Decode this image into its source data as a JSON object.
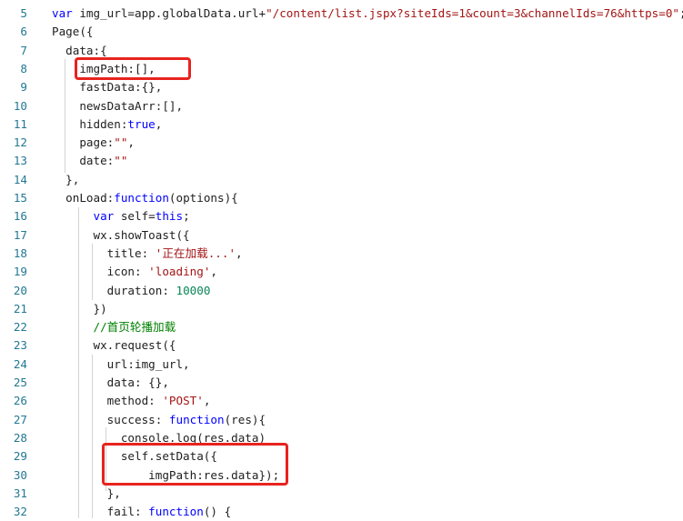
{
  "editor": {
    "lines": [
      {
        "no": "5",
        "segments": [
          {
            "t": "var",
            "c": "kw"
          },
          {
            "t": " img_url=app.globalData.url+",
            "c": ""
          },
          {
            "t": "\"/content/list.jspx?siteIds=1&count=3&channelIds=76&https=0\"",
            "c": "str"
          },
          {
            "t": ";",
            "c": ""
          }
        ]
      },
      {
        "no": "6",
        "segments": [
          {
            "t": "Page({",
            "c": ""
          }
        ]
      },
      {
        "no": "7",
        "segments": [
          {
            "t": "  data:{",
            "c": ""
          }
        ]
      },
      {
        "no": "8",
        "segments": [
          {
            "t": "    imgPath:[],",
            "c": ""
          }
        ]
      },
      {
        "no": "9",
        "segments": [
          {
            "t": "    fastData:{},",
            "c": ""
          }
        ]
      },
      {
        "no": "10",
        "segments": [
          {
            "t": "    newsDataArr:[],",
            "c": ""
          }
        ]
      },
      {
        "no": "11",
        "segments": [
          {
            "t": "    hidden:",
            "c": ""
          },
          {
            "t": "true",
            "c": "kw"
          },
          {
            "t": ",",
            "c": ""
          }
        ]
      },
      {
        "no": "12",
        "segments": [
          {
            "t": "    page:",
            "c": ""
          },
          {
            "t": "\"\"",
            "c": "str"
          },
          {
            "t": ",",
            "c": ""
          }
        ]
      },
      {
        "no": "13",
        "segments": [
          {
            "t": "    date:",
            "c": ""
          },
          {
            "t": "\"\"",
            "c": "str"
          }
        ]
      },
      {
        "no": "14",
        "segments": [
          {
            "t": "  },",
            "c": ""
          }
        ]
      },
      {
        "no": "15",
        "segments": [
          {
            "t": "  onLoad:",
            "c": ""
          },
          {
            "t": "function",
            "c": "kw"
          },
          {
            "t": "(options){",
            "c": ""
          }
        ]
      },
      {
        "no": "16",
        "segments": [
          {
            "t": "      ",
            "c": ""
          },
          {
            "t": "var",
            "c": "kw"
          },
          {
            "t": " self=",
            "c": ""
          },
          {
            "t": "this",
            "c": "kw"
          },
          {
            "t": ";",
            "c": ""
          }
        ]
      },
      {
        "no": "17",
        "segments": [
          {
            "t": "      wx.showToast({",
            "c": ""
          }
        ]
      },
      {
        "no": "18",
        "segments": [
          {
            "t": "        title: ",
            "c": ""
          },
          {
            "t": "'正在加载...'",
            "c": "str"
          },
          {
            "t": ",",
            "c": ""
          }
        ]
      },
      {
        "no": "19",
        "segments": [
          {
            "t": "        icon: ",
            "c": ""
          },
          {
            "t": "'loading'",
            "c": "str"
          },
          {
            "t": ",",
            "c": ""
          }
        ]
      },
      {
        "no": "20",
        "segments": [
          {
            "t": "        duration: ",
            "c": ""
          },
          {
            "t": "10000",
            "c": "num"
          }
        ]
      },
      {
        "no": "21",
        "segments": [
          {
            "t": "      })",
            "c": ""
          }
        ]
      },
      {
        "no": "22",
        "segments": [
          {
            "t": "      //首页轮播加载",
            "c": "cm"
          }
        ]
      },
      {
        "no": "23",
        "segments": [
          {
            "t": "      wx.request({",
            "c": ""
          }
        ]
      },
      {
        "no": "24",
        "segments": [
          {
            "t": "        url:img_url,",
            "c": ""
          }
        ]
      },
      {
        "no": "25",
        "segments": [
          {
            "t": "        data: {},",
            "c": ""
          }
        ]
      },
      {
        "no": "26",
        "segments": [
          {
            "t": "        method: ",
            "c": ""
          },
          {
            "t": "'POST'",
            "c": "str"
          },
          {
            "t": ",",
            "c": ""
          }
        ]
      },
      {
        "no": "27",
        "segments": [
          {
            "t": "        success: ",
            "c": ""
          },
          {
            "t": "function",
            "c": "kw"
          },
          {
            "t": "(res){",
            "c": ""
          }
        ]
      },
      {
        "no": "28",
        "segments": [
          {
            "t": "          console.log(res.data)",
            "c": ""
          }
        ]
      },
      {
        "no": "29",
        "segments": [
          {
            "t": "          self.setData({",
            "c": ""
          }
        ]
      },
      {
        "no": "30",
        "segments": [
          {
            "t": "              imgPath:res.data});",
            "c": ""
          }
        ]
      },
      {
        "no": "31",
        "segments": [
          {
            "t": "        },",
            "c": ""
          }
        ]
      },
      {
        "no": "32",
        "segments": [
          {
            "t": "        fail: ",
            "c": ""
          },
          {
            "t": "function",
            "c": "kw"
          },
          {
            "t": "() {",
            "c": ""
          }
        ]
      }
    ]
  },
  "colors": {
    "keyword": "#0000ff",
    "string": "#a31515",
    "number": "#098658",
    "comment": "#008000",
    "line_number": "#237893",
    "highlight_box": "#e8231f"
  }
}
